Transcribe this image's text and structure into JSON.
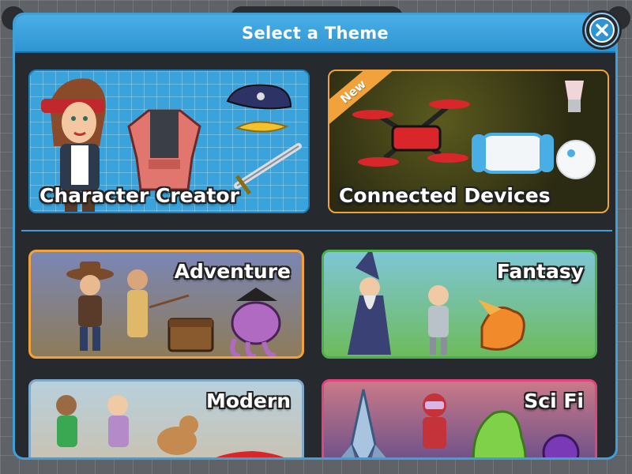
{
  "modal": {
    "title": "Select a Theme",
    "close_icon": "close-icon"
  },
  "featured": [
    {
      "label": "Character Creator",
      "border": "#2f95d2"
    },
    {
      "label": "Connected Devices",
      "badge": "New",
      "border": "#f1a23a"
    }
  ],
  "themes": [
    {
      "label": "Adventure",
      "border": "#f1a23a"
    },
    {
      "label": "Fantasy",
      "border": "#4caf50"
    },
    {
      "label": "Modern",
      "border": "#7fa8c9"
    },
    {
      "label": "Sci Fi",
      "border": "#e0457b"
    }
  ],
  "colors": {
    "accent": "#3fa0d8",
    "panel": "#26292e"
  }
}
